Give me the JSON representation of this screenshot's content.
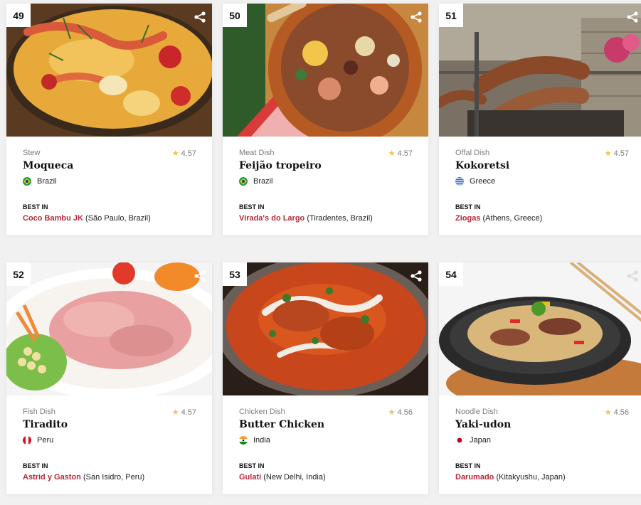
{
  "cards": [
    {
      "rank": "49",
      "type": "Stew",
      "rating": "4.57",
      "name": "Moqueca",
      "country": "Brazil",
      "best_label": "BEST IN",
      "place": "Coco Bambu JK",
      "location": "(São Paulo, Brazil)"
    },
    {
      "rank": "50",
      "type": "Meat Dish",
      "rating": "4.57",
      "name": "Feijão tropeiro",
      "country": "Brazil",
      "best_label": "BEST IN",
      "place": "Virada's do Largo",
      "location": "(Tiradentes, Brazil)"
    },
    {
      "rank": "51",
      "type": "Offal Dish",
      "rating": "4.57",
      "name": "Kokoretsi",
      "country": "Greece",
      "best_label": "BEST IN",
      "place": "Ziogas",
      "location": "(Athens, Greece)"
    },
    {
      "rank": "52",
      "type": "Fish Dish",
      "rating": "4.57",
      "name": "Tiradito",
      "country": "Peru",
      "best_label": "BEST IN",
      "place": "Astrid y Gaston",
      "location": "(San Isidro, Peru)"
    },
    {
      "rank": "53",
      "type": "Chicken Dish",
      "rating": "4.56",
      "name": "Butter Chicken",
      "country": "India",
      "best_label": "BEST IN",
      "place": "Gulati",
      "location": "(New Delhi, India)"
    },
    {
      "rank": "54",
      "type": "Noodle Dish",
      "rating": "4.56",
      "name": "Yaki-udon",
      "country": "Japan",
      "best_label": "BEST IN",
      "place": "Darumado",
      "location": "(Kitakyushu, Japan)"
    }
  ],
  "colors": {
    "accent": "#b8283a",
    "star": "#f2c14e"
  },
  "icons": {
    "share": "share-icon",
    "rating": "star-icon"
  }
}
